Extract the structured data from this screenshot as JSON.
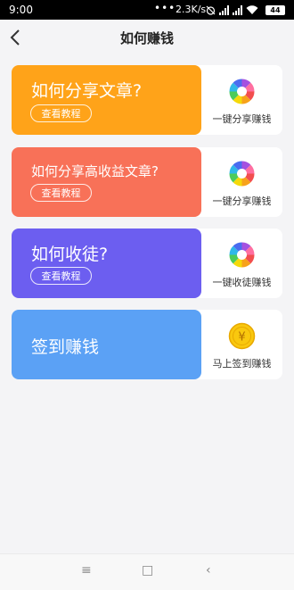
{
  "status_bar": {
    "time": "9:00",
    "dots": "•••",
    "speed": "2.3K/s",
    "battery": "44"
  },
  "header": {
    "title": "如何赚钱",
    "back_icon": "chevron-left-icon"
  },
  "cards": [
    {
      "title": "如何分享文章?",
      "button": "查看教程",
      "action": "一键分享赚钱",
      "color": "#ffa319",
      "icon": "aperture-icon"
    },
    {
      "title": "如何分享高收益文章?",
      "button": "查看教程",
      "action": "一键分享赚钱",
      "color": "#f87158",
      "icon": "aperture-icon"
    },
    {
      "title": "如何收徒?",
      "button": "查看教程",
      "action": "一键收徒赚钱",
      "color": "#6c5ef0",
      "icon": "aperture-icon"
    },
    {
      "title": "签到赚钱",
      "action": "马上签到赚钱",
      "color": "#5ba1f5",
      "icon": "yen-coin-icon",
      "icon_symbol": "¥"
    }
  ],
  "nav_bar": {
    "menu_icon": "≡",
    "home_icon": "□",
    "back_icon": "‹"
  }
}
